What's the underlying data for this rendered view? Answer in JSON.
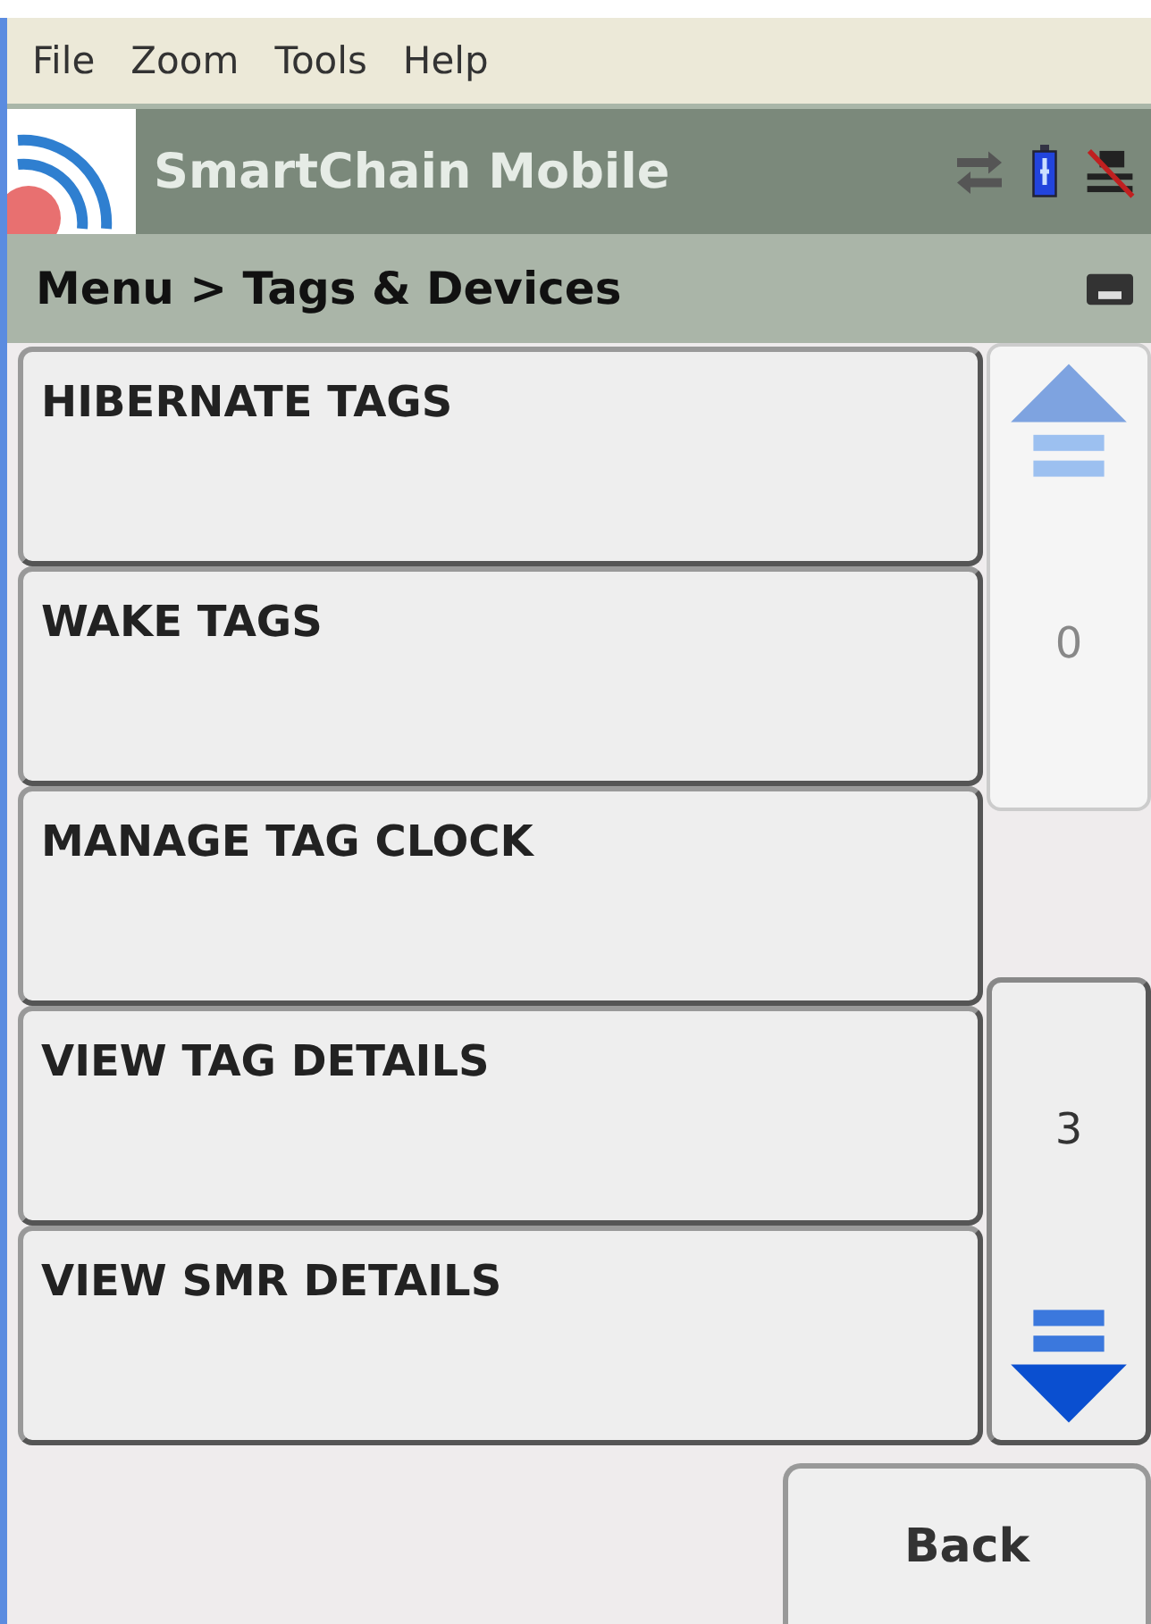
{
  "menu_bar": [
    "File",
    "Zoom",
    "Tools",
    "Help"
  ],
  "header": {
    "title": "SmartChain Mobile"
  },
  "breadcrumb": "Menu > Tags & Devices",
  "menu_items": [
    {
      "label": "HIBERNATE TAGS"
    },
    {
      "label": "WAKE TAGS"
    },
    {
      "label": "MANAGE TAG CLOCK"
    },
    {
      "label": "VIEW TAG DETAILS"
    },
    {
      "label": "VIEW SMR DETAILS"
    }
  ],
  "scroll": [
    {
      "kind": "up",
      "count": "0",
      "disabled": true
    },
    {
      "kind": "down",
      "count": "3",
      "disabled": false
    }
  ],
  "buttons": [
    "Back"
  ]
}
